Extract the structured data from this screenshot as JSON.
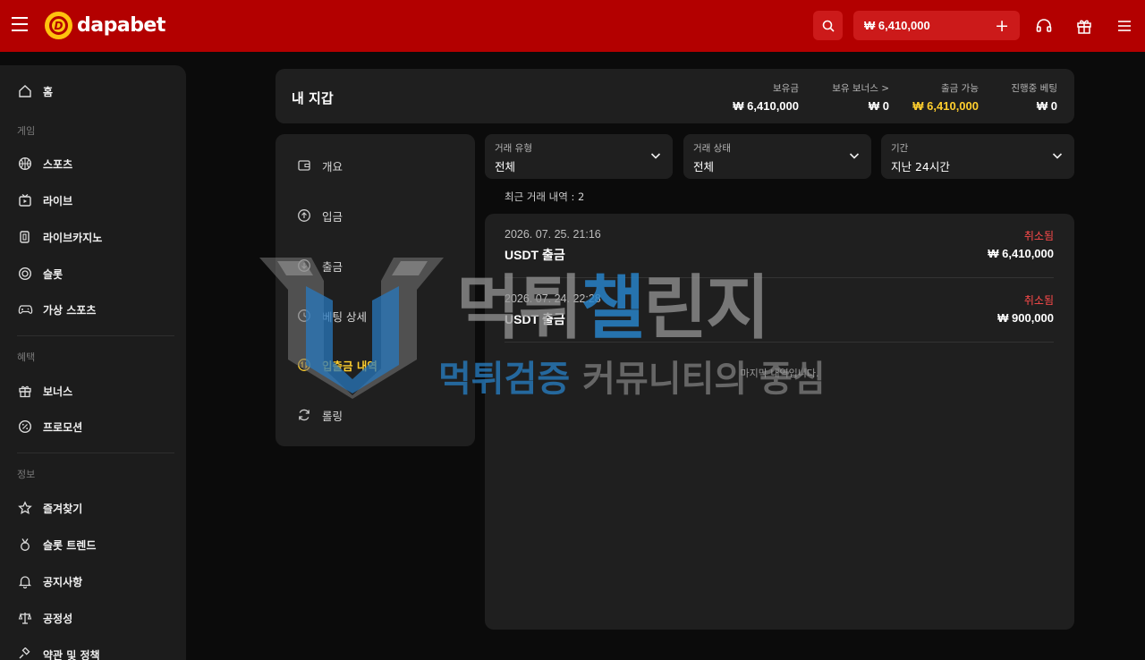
{
  "header": {
    "brand": "dapabet",
    "brand_mark": "D",
    "balance": "₩ 6,410,000",
    "plus": "+"
  },
  "sidebar": {
    "home": "홈",
    "section_game": "게임",
    "sports": "스포츠",
    "live": "라이브",
    "live_casino": "라이브카지노",
    "slots": "슬롯",
    "virtual_sports": "가상 스포츠",
    "section_benefits": "혜택",
    "bonus": "보너스",
    "promotion": "프로모션",
    "section_info": "정보",
    "favorites": "즐겨찾기",
    "slot_trend": "슬롯 트렌드",
    "notice": "공지사항",
    "fairness": "공정성",
    "terms": "약관 및 정책"
  },
  "wallet": {
    "title": "내 지갑",
    "stats": [
      {
        "label": "보유금",
        "value": "₩ 6,410,000"
      },
      {
        "label": "보유 보너스 >",
        "value": "₩ 0"
      },
      {
        "label": "출금 가능",
        "value": "₩ 6,410,000"
      },
      {
        "label": "진행중 베팅",
        "value": "₩ 0"
      }
    ]
  },
  "menu": {
    "overview": "개요",
    "deposit": "입금",
    "withdraw": "출금",
    "bet_detail": "베팅 상세",
    "history": "입출금 내역",
    "rolling": "롤링"
  },
  "filters": [
    {
      "label": "거래 유형",
      "value": "전체"
    },
    {
      "label": "거래 상태",
      "value": "전체"
    },
    {
      "label": "기간",
      "value": "지난 24시간"
    }
  ],
  "recent_count": "최근 거래 내역 : 2",
  "transactions": [
    {
      "date": "2026. 07. 25. 21:16",
      "name": "USDT 출금",
      "status": "취소됨",
      "amount": "₩ 6,410,000"
    },
    {
      "date": "2026. 07. 24. 22:28",
      "name": "USDT 출금",
      "status": "취소됨",
      "amount": "₩ 900,000"
    }
  ],
  "end_note": "마지막 내역입니다.",
  "watermark": {
    "line1_a": "먹튀",
    "line1_b": "챌",
    "line1_c": "린지",
    "line2_a": "먹튀검증",
    "line2_b": " 커뮤니티의 중심"
  },
  "colors": {
    "header_red": "#b30000",
    "gold": "#ffcf2e",
    "cancel_red": "#ff4b4b",
    "panel": "#1f1f1f"
  }
}
